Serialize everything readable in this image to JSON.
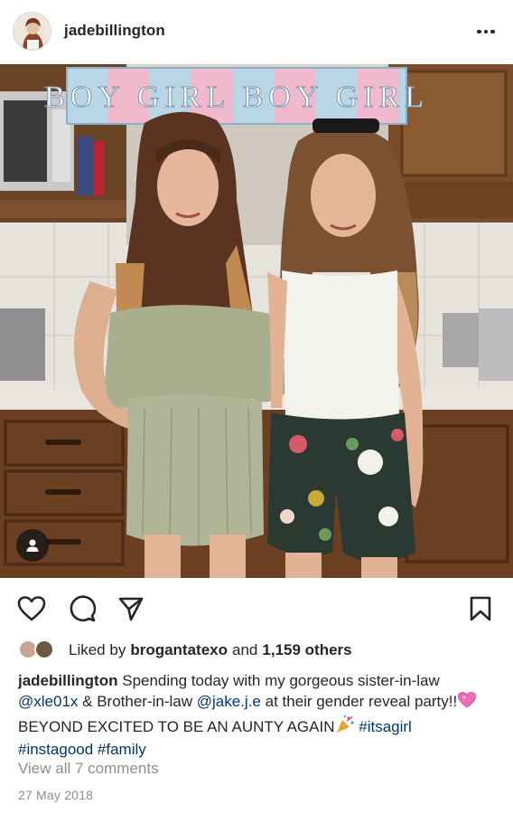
{
  "post": {
    "username": "jadebillington",
    "more_icon": "more-horizontal-icon"
  },
  "photo": {
    "banner_text": "BOY GIRL BOY GIRL"
  },
  "actions": {
    "like_icon": "heart-icon",
    "comment_icon": "comment-icon",
    "share_icon": "send-icon",
    "save_icon": "bookmark-icon"
  },
  "likes": {
    "prefix": "Liked by",
    "first_liker": "brogantatexo",
    "and": "and",
    "others": "1,159 others"
  },
  "caption": {
    "username": "jadebillington",
    "text_1": "Spending today with my gorgeous sister-in-law",
    "mention_1": "@xle01x",
    "text_2": "& Brother-in-law",
    "mention_2": "@jake.j.e",
    "text_3": "at their gender reveal party!!",
    "text_4": "BEYOND EXCITED TO BE AN AUNTY AGAIN",
    "hashtag_1": "#itsagirl",
    "hashtag_2": "#instagood",
    "hashtag_3": "#family"
  },
  "comments_link": "View all 7 comments",
  "date": "27 May 2018"
}
